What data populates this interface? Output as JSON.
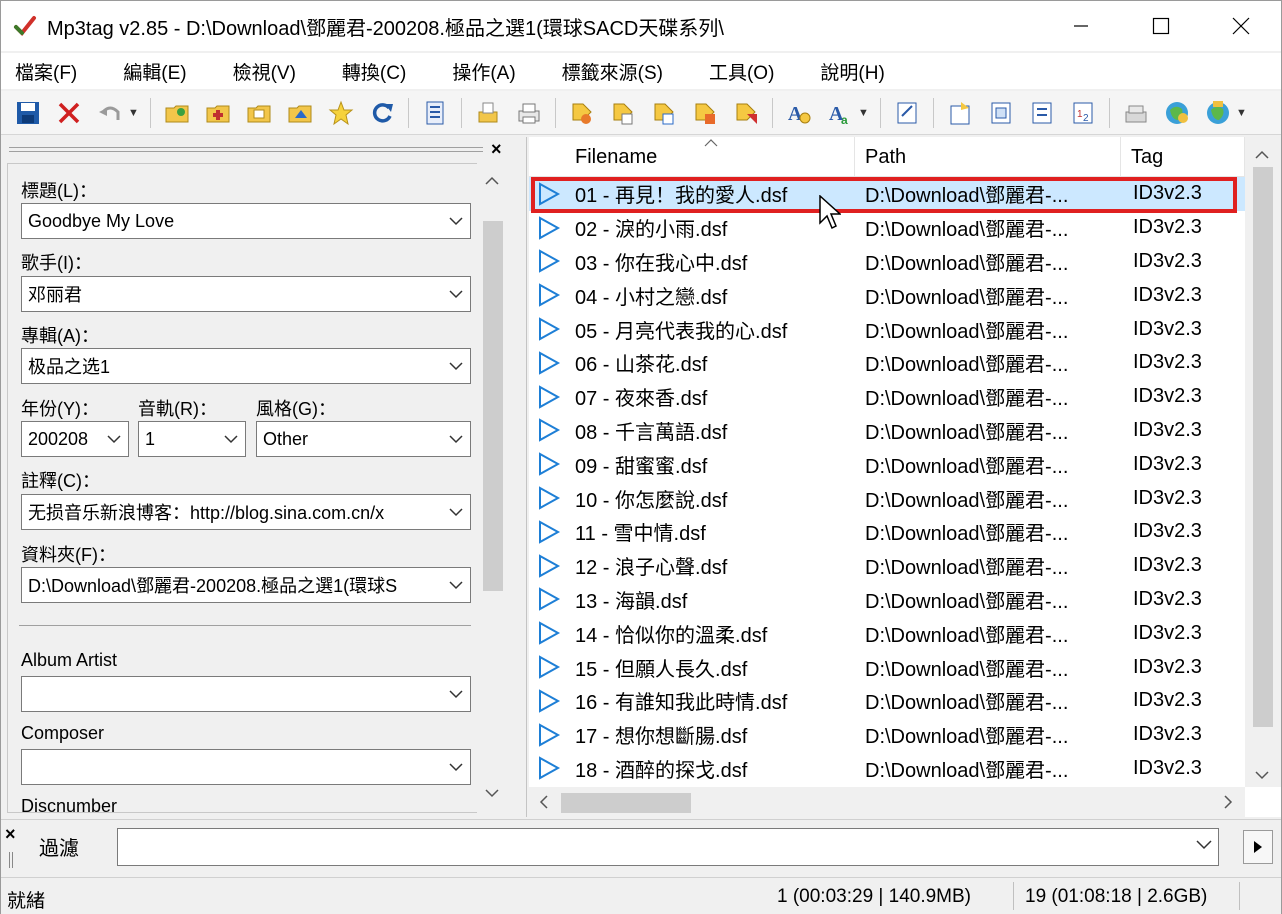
{
  "window": {
    "title": "Mp3tag v2.85  -  D:\\Download\\鄧麗君-200208.極品之選1(環球SACD天碟系列\\",
    "controls": [
      "minimize-icon",
      "maximize-icon",
      "close-icon"
    ]
  },
  "menu": [
    {
      "label": "檔案(F)"
    },
    {
      "label": "編輯(E)"
    },
    {
      "label": "檢視(V)"
    },
    {
      "label": "轉換(C)"
    },
    {
      "label": "操作(A)"
    },
    {
      "label": "標籤來源(S)"
    },
    {
      "label": "工具(O)"
    },
    {
      "label": "說明(H)"
    }
  ],
  "toolbar": {
    "icons": [
      "save-icon",
      "remove-tag-icon",
      "undo-icon",
      "change-directory-icon",
      "add-directory-icon",
      "open-folder-icon",
      "folder-favorites-icon",
      "favorites-star-icon",
      "refresh-icon",
      "select-all-icon",
      "export-icon",
      "print-icon",
      "tag-filename-icon",
      "filename-tag-icon",
      "filename-filename-icon",
      "text-tag-icon",
      "tag-tag-icon",
      "autonumber-icon",
      "actions-icon",
      "extended-tags-icon",
      "playlist-icon",
      "tag-sources-icon",
      "web-sources-icon",
      "options-icon",
      "freedb-icon",
      "amazon-icon"
    ]
  },
  "tag_panel": {
    "title_label": "標題(L)：",
    "title_value": "Goodbye My Love",
    "artist_label": "歌手(I)：",
    "artist_value": "邓丽君",
    "album_label": "專輯(A)：",
    "album_value": "极品之选1",
    "year_label": "年份(Y)：",
    "year_value": "200208",
    "track_label": "音軌(R)：",
    "track_value": "1",
    "genre_label": "風格(G)：",
    "genre_value": "Other",
    "comment_label": "註釋(C)：",
    "comment_value": "无损音乐新浪博客：http://blog.sina.com.cn/x",
    "directory_label": "資料夾(F)：",
    "directory_value": "D:\\Download\\鄧麗君-200208.極品之選1(環球S",
    "album_artist_label": "Album Artist",
    "album_artist_value": "",
    "composer_label": "Composer",
    "composer_value": "",
    "discnumber_label": "Discnumber"
  },
  "file_list": {
    "columns": {
      "filename": "Filename",
      "path": "Path",
      "tag": "Tag"
    },
    "rows": [
      {
        "filename": "01 - 再見！我的愛人.dsf",
        "path": "D:\\Download\\鄧麗君-...",
        "tag": "ID3v2.3",
        "selected": true
      },
      {
        "filename": "02 - 淚的小雨.dsf",
        "path": "D:\\Download\\鄧麗君-...",
        "tag": "ID3v2.3"
      },
      {
        "filename": "03 - 你在我心中.dsf",
        "path": "D:\\Download\\鄧麗君-...",
        "tag": "ID3v2.3"
      },
      {
        "filename": "04 - 小村之戀.dsf",
        "path": "D:\\Download\\鄧麗君-...",
        "tag": "ID3v2.3"
      },
      {
        "filename": "05 - 月亮代表我的心.dsf",
        "path": "D:\\Download\\鄧麗君-...",
        "tag": "ID3v2.3"
      },
      {
        "filename": "06 - 山茶花.dsf",
        "path": "D:\\Download\\鄧麗君-...",
        "tag": "ID3v2.3"
      },
      {
        "filename": "07 - 夜來香.dsf",
        "path": "D:\\Download\\鄧麗君-...",
        "tag": "ID3v2.3"
      },
      {
        "filename": "08 - 千言萬語.dsf",
        "path": "D:\\Download\\鄧麗君-...",
        "tag": "ID3v2.3"
      },
      {
        "filename": "09 - 甜蜜蜜.dsf",
        "path": "D:\\Download\\鄧麗君-...",
        "tag": "ID3v2.3"
      },
      {
        "filename": "10 - 你怎麼說.dsf",
        "path": "D:\\Download\\鄧麗君-...",
        "tag": "ID3v2.3"
      },
      {
        "filename": "11 - 雪中情.dsf",
        "path": "D:\\Download\\鄧麗君-...",
        "tag": "ID3v2.3"
      },
      {
        "filename": "12 - 浪子心聲.dsf",
        "path": "D:\\Download\\鄧麗君-...",
        "tag": "ID3v2.3"
      },
      {
        "filename": "13 - 海韻.dsf",
        "path": "D:\\Download\\鄧麗君-...",
        "tag": "ID3v2.3"
      },
      {
        "filename": "14 - 恰似你的溫柔.dsf",
        "path": "D:\\Download\\鄧麗君-...",
        "tag": "ID3v2.3"
      },
      {
        "filename": "15 - 但願人長久.dsf",
        "path": "D:\\Download\\鄧麗君-...",
        "tag": "ID3v2.3"
      },
      {
        "filename": "16 - 有誰知我此時情.dsf",
        "path": "D:\\Download\\鄧麗君-...",
        "tag": "ID3v2.3"
      },
      {
        "filename": "17 - 想你想斷腸.dsf",
        "path": "D:\\Download\\鄧麗君-...",
        "tag": "ID3v2.3"
      },
      {
        "filename": "18 - 酒醉的探戈.dsf",
        "path": "D:\\Download\\鄧麗君-...",
        "tag": "ID3v2.3"
      }
    ]
  },
  "filter": {
    "label": "過濾",
    "value": ""
  },
  "status": {
    "left": "就緒",
    "selection": "1 (00:03:29 | 140.9MB)",
    "total": "19 (01:08:18 | 2.6GB)"
  },
  "colors": {
    "selection_bg": "#cce8ff",
    "highlight_border": "#e02020",
    "play_icon": "#1e7fd6"
  }
}
